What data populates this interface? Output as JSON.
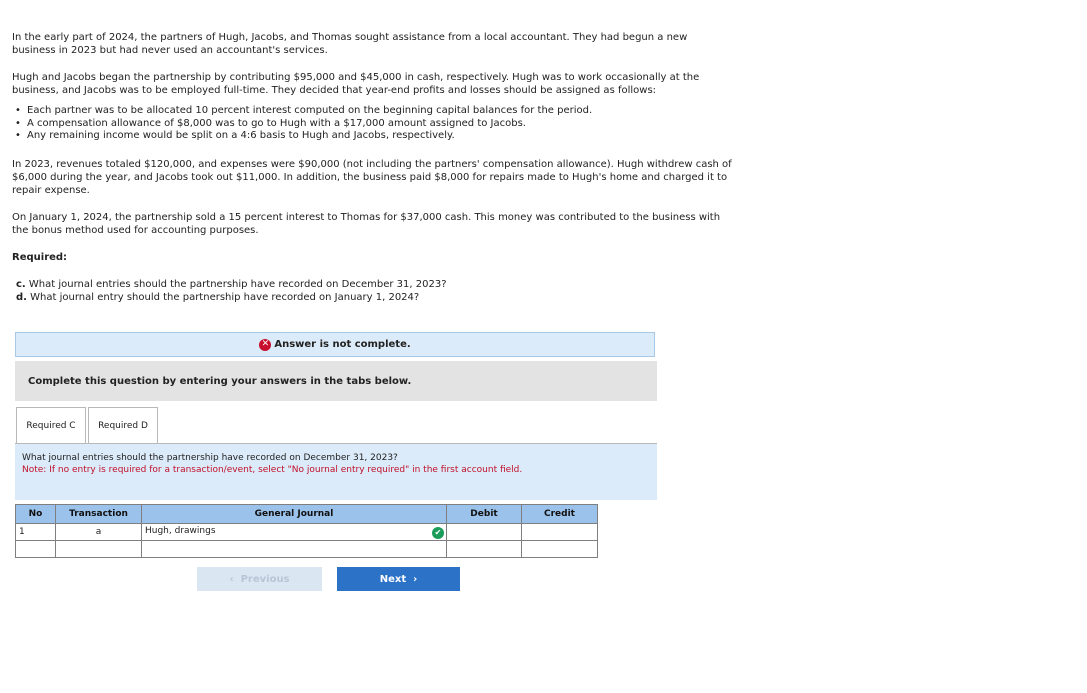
{
  "problem": {
    "p1": "In the early part of 2024, the partners of Hugh, Jacobs, and Thomas sought assistance from a local accountant. They had begun a new business in 2023 but had never used an accountant's services.",
    "p2": "Hugh and Jacobs began the partnership by contributing $95,000 and $45,000 in cash, respectively. Hugh was to work occasionally at the business, and Jacobs was to be employed full-time. They decided that year-end profits and losses should be assigned as follows:",
    "bullets": [
      "Each partner was to be allocated 10 percent interest computed on the beginning capital balances for the period.",
      "A compensation allowance of $8,000 was to go to Hugh with a $17,000 amount assigned to Jacobs.",
      "Any remaining income would be split on a 4:6 basis to Hugh and Jacobs, respectively."
    ],
    "p3": "In 2023, revenues totaled $120,000, and expenses were $90,000 (not including the partners' compensation allowance). Hugh withdrew cash of $6,000 during the year, and Jacobs took out $11,000. In addition, the business paid $8,000 for repairs made to Hugh's home and charged it to repair expense.",
    "p4": "On January 1, 2024, the partnership sold a 15 percent interest to Thomas for $37,000 cash. This money was contributed to the business with the bonus method used for accounting purposes.",
    "required_label": "Required:",
    "q_c_letter": "c.",
    "q_c": "What journal entries should the partnership have recorded on December 31, 2023?",
    "q_d_letter": "d.",
    "q_d": "What journal entry should the partnership have recorded on January 1, 2024?"
  },
  "status": {
    "icon": "x-circle-icon",
    "text": "Answer is not complete."
  },
  "instruction": "Complete this question by entering your answers in the tabs below.",
  "tabs": [
    {
      "label": "Required C"
    },
    {
      "label": "Required D"
    }
  ],
  "question_box": {
    "text": "What journal entries should the partnership have recorded on December 31, 2023?",
    "note": "Note: If no entry is required for a transaction/event, select \"No journal entry required\" in the first account field."
  },
  "journal": {
    "headers": {
      "no": "No",
      "transaction": "Transaction",
      "general_journal": "General Journal",
      "debit": "Debit",
      "credit": "Credit"
    },
    "rows": [
      {
        "no": "1",
        "transaction": "a",
        "account": "Hugh, drawings",
        "debit": "",
        "credit": "",
        "status_icon": "check-circle-icon"
      },
      {
        "no": "",
        "transaction": "",
        "account": "",
        "debit": "",
        "credit": ""
      }
    ]
  },
  "nav": {
    "prev_label": "Previous",
    "next_label": "Next"
  },
  "colors": {
    "banner_bg": "#dcebf9",
    "header_bg": "#9bc2ea",
    "next_btn": "#2c72c7",
    "error_red": "#c8102e",
    "check_green": "#1a9c5a"
  }
}
